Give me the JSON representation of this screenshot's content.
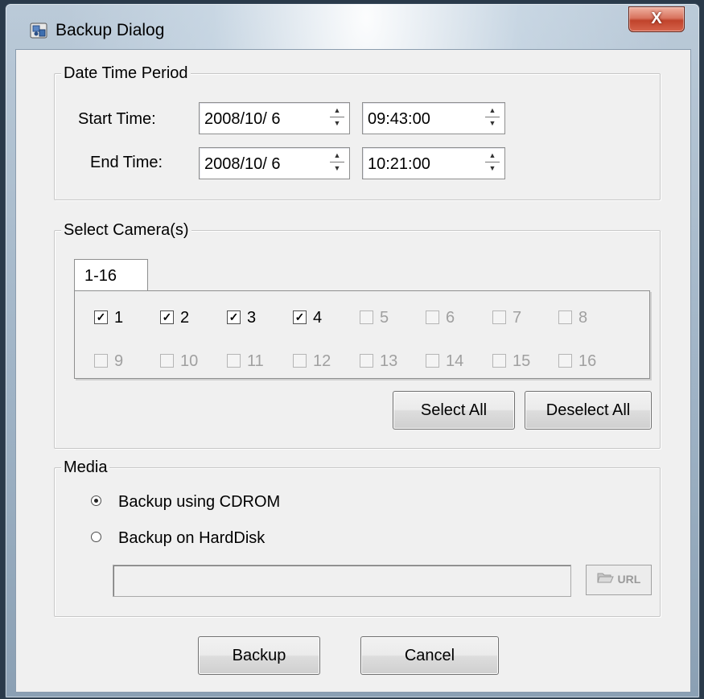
{
  "window": {
    "title": "Backup Dialog",
    "close_glyph": "X",
    "icon": "app-camera-icon"
  },
  "date_time_period": {
    "title": "Date Time Period",
    "start_label": "Start Time:",
    "start_date": "2008/10/ 6",
    "start_time": "09:43:00",
    "end_label": "End Time:",
    "end_date": "2008/10/ 6",
    "end_time": "10:21:00"
  },
  "select_cameras": {
    "title": "Select Camera(s)",
    "tab_label": "1-16",
    "cameras": [
      {
        "label": "1",
        "checked": true,
        "enabled": true
      },
      {
        "label": "2",
        "checked": true,
        "enabled": true
      },
      {
        "label": "3",
        "checked": true,
        "enabled": true
      },
      {
        "label": "4",
        "checked": true,
        "enabled": true
      },
      {
        "label": "5",
        "checked": false,
        "enabled": false
      },
      {
        "label": "6",
        "checked": false,
        "enabled": false
      },
      {
        "label": "7",
        "checked": false,
        "enabled": false
      },
      {
        "label": "8",
        "checked": false,
        "enabled": false
      },
      {
        "label": "9",
        "checked": false,
        "enabled": false
      },
      {
        "label": "10",
        "checked": false,
        "enabled": false
      },
      {
        "label": "11",
        "checked": false,
        "enabled": false
      },
      {
        "label": "12",
        "checked": false,
        "enabled": false
      },
      {
        "label": "13",
        "checked": false,
        "enabled": false
      },
      {
        "label": "14",
        "checked": false,
        "enabled": false
      },
      {
        "label": "15",
        "checked": false,
        "enabled": false
      },
      {
        "label": "16",
        "checked": false,
        "enabled": false
      }
    ],
    "select_all_label": "Select All",
    "deselect_all_label": "Deselect All"
  },
  "media": {
    "title": "Media",
    "option_cdrom": "Backup using CDROM",
    "option_harddisk": "Backup on HardDisk",
    "selected": "cdrom",
    "path_value": "",
    "url_button_label": "URL"
  },
  "footer": {
    "backup_label": "Backup",
    "cancel_label": "Cancel"
  },
  "colors": {
    "close_button": "#c0432b",
    "client_bg": "#f0f0f0"
  }
}
